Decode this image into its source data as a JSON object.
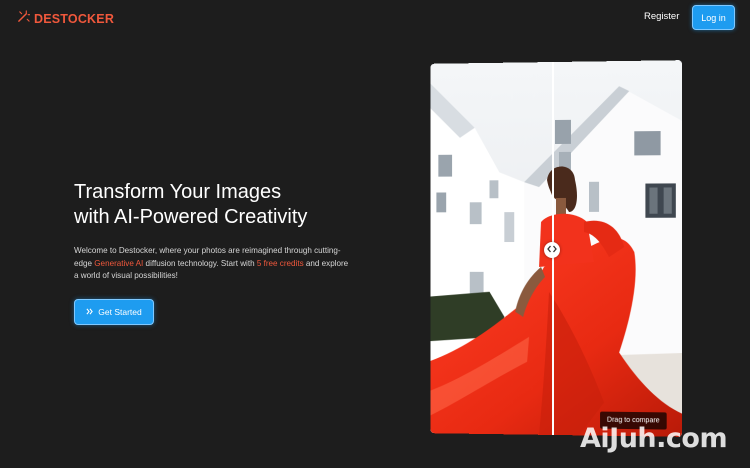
{
  "header": {
    "brand": "DESTOCKER",
    "register_label": "Register",
    "login_label": "Log in"
  },
  "hero": {
    "title_line1": "Transform Your Images",
    "title_line2": "with AI-Powered Creativity",
    "desc_part1": "Welcome to Destocker, where your photos are reimagined through cutting-edge ",
    "desc_highlight1": "Generative AI",
    "desc_part2": " diffusion technology. Start with ",
    "desc_highlight2": "5 free credits",
    "desc_part3": " and explore a world of visual possibilities!",
    "cta_label": "Get Started"
  },
  "compare": {
    "drag_hint": "Drag to compare"
  },
  "watermark": "AiJuh.com",
  "colors": {
    "accent": "#f0583c",
    "button": "#1e9cf0",
    "background": "#1d1d1d"
  }
}
